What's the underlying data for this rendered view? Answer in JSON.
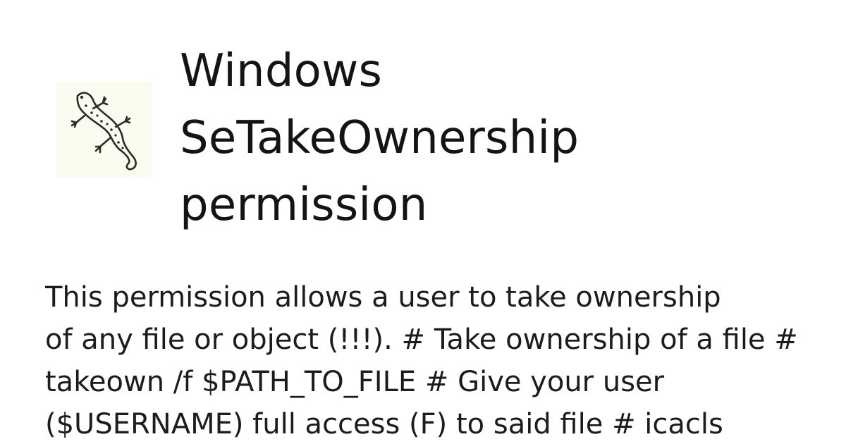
{
  "logo": {
    "icon": "gecko-icon",
    "background": "#fbfbf0"
  },
  "title_lines": [
    "Windows",
    "SeTakeOwnership",
    "permission"
  ],
  "description_lines": [
    "This permission allows a user to take ownership",
    "of any file or object (!!!). # Take ownership of a file #",
    "takeown /f $PATH_TO_FILE # Give your user",
    "($USERNAME) full access (F) to said file # icacls"
  ]
}
